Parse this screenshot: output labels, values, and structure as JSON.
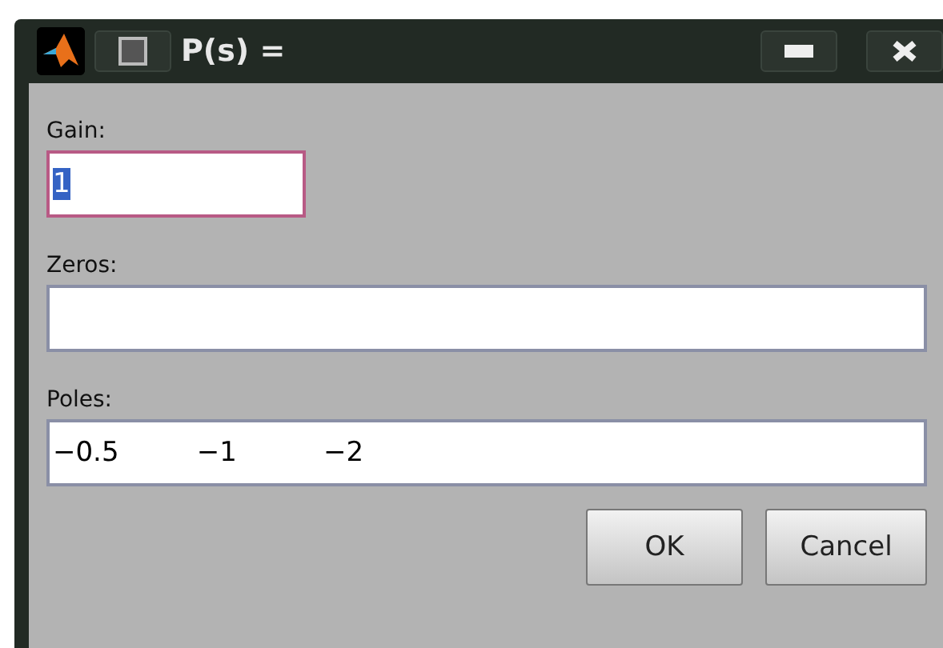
{
  "window": {
    "title": "P(s) ="
  },
  "fields": [
    {
      "label": "Gain:",
      "value": "1",
      "focused": true,
      "selected_text": true,
      "wide": false
    },
    {
      "label": "Zeros:",
      "focused": false,
      "wide": true
    },
    {
      "label": "Poles:",
      "value": "−0.5         −1          −2",
      "focused": false,
      "wide": true
    }
  ],
  "buttons": [
    "OK",
    "Cancel"
  ]
}
